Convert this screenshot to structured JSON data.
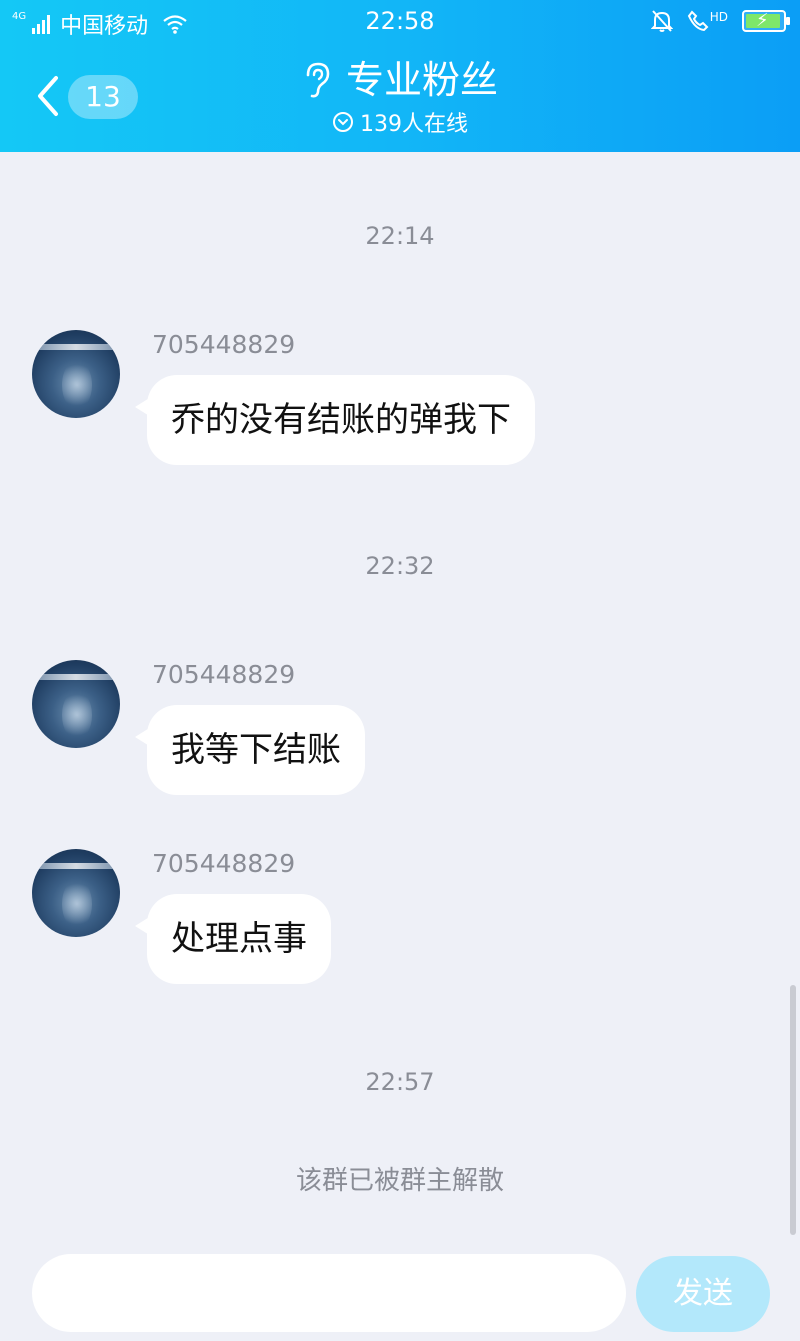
{
  "status_bar": {
    "network": "4G",
    "carrier": "中国移动",
    "time": "22:58",
    "hd_label": "HD",
    "battery_icon": "battery-charging-icon"
  },
  "header": {
    "back_count": "13",
    "title": "专业粉丝",
    "subtitle": "139人在线",
    "title_icon": "ear-icon",
    "subtitle_icon": "chevron-down-circle-icon"
  },
  "messages": [
    {
      "time": "22:14",
      "sender": "705448829",
      "text": "乔的没有结账的弹我下"
    },
    {
      "time": "22:32",
      "sender": "705448829",
      "text": "我等下结账"
    },
    {
      "time": "",
      "sender": "705448829",
      "text": "处理点事"
    }
  ],
  "final_time": "22:57",
  "system_notice": "该群已被群主解散",
  "input": {
    "placeholder": "",
    "value": ""
  },
  "send_label": "发送",
  "colors": {
    "header_start": "#14c8f6",
    "header_end": "#0b9ef6",
    "background": "#eef0f7",
    "send_button": "#b3e8fb"
  }
}
